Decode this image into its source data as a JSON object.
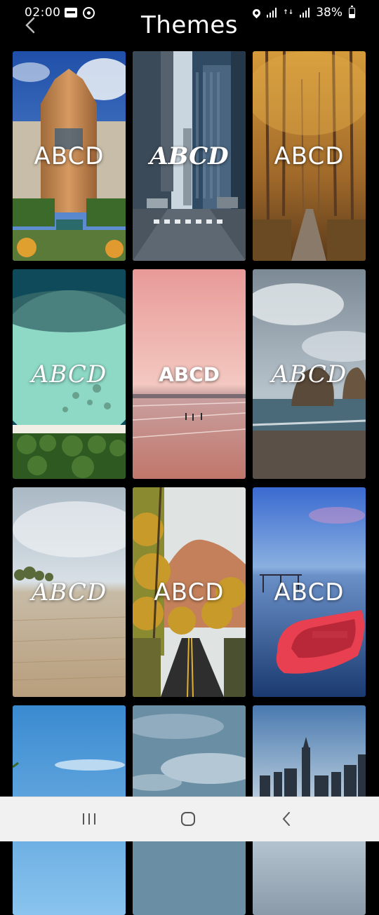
{
  "status_bar": {
    "time": "02:00",
    "battery": "38%",
    "battery_level": 0.38
  },
  "header": {
    "title": "Themes"
  },
  "themes": [
    {
      "text": "ABCD"
    },
    {
      "text": "ABCD"
    },
    {
      "text": "ABCD"
    },
    {
      "text": "ABCD"
    },
    {
      "text": "ABCD"
    },
    {
      "text": "ABCD"
    },
    {
      "text": "ABCD"
    },
    {
      "text": "ABCD"
    },
    {
      "text": "ABCD"
    },
    {
      "text": ""
    },
    {
      "text": ""
    },
    {
      "text": ""
    }
  ],
  "nav_bar": {
    "recents_icon": "recents-icon",
    "home_icon": "home-icon",
    "back_icon": "back-icon"
  }
}
